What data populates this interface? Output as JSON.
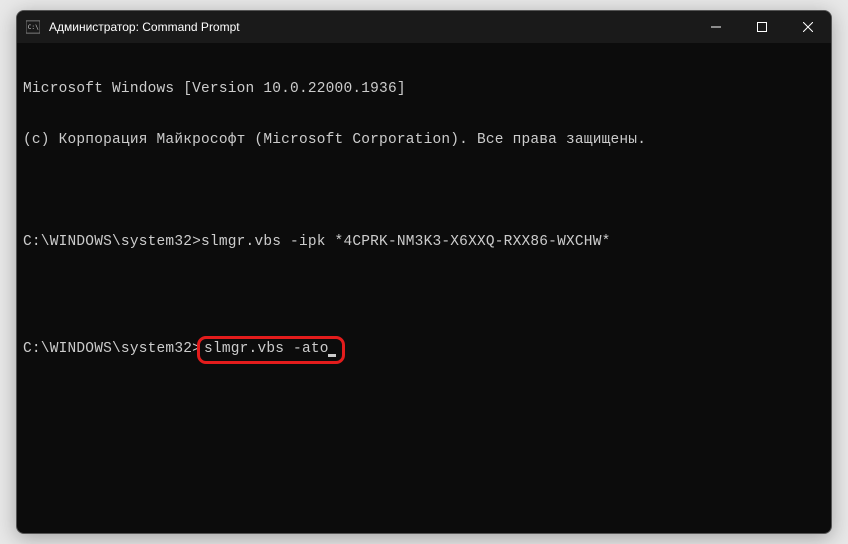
{
  "titlebar": {
    "title": "Администратор: Command Prompt"
  },
  "terminal": {
    "line1": "Microsoft Windows [Version 10.0.22000.1936]",
    "line2": "(c) Корпорация Майкрософт (Microsoft Corporation). Все права защищены.",
    "prompt1": "C:\\WINDOWS\\system32>",
    "command1": "slmgr.vbs -ipk *4CPRK-NM3K3-X6XXQ-RXX86-WXCHW*",
    "prompt2": "C:\\WINDOWS\\system32>",
    "command2": "slmgr.vbs -ato"
  }
}
